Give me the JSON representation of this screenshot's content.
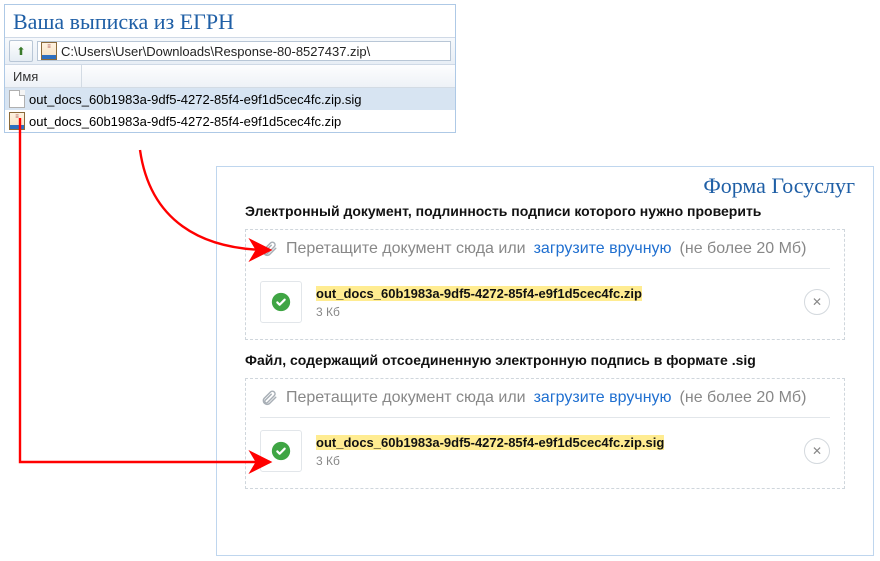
{
  "explorer": {
    "title": "Ваша выписка из ЕГРН",
    "path": "C:\\Users\\User\\Downloads\\Response-80-8527437.zip\\",
    "col_name": "Имя",
    "files": [
      {
        "name": "out_docs_60b1983a-9df5-4272-85f4-e9f1d5cec4fc.zip.sig",
        "icon": "blank",
        "selected": true
      },
      {
        "name": "out_docs_60b1983a-9df5-4272-85f4-e9f1d5cec4fc.zip",
        "icon": "rar",
        "selected": false
      }
    ]
  },
  "form": {
    "title": "Форма Госуслуг",
    "drop_text": "Перетащите документ сюда или",
    "upload_link": "загрузите вручную",
    "limit_text": "(не более 20 Мб)",
    "sections": [
      {
        "label": "Электронный документ, подлинность подписи которого нужно проверить",
        "file_name_hl": "out_docs_",
        "file_name_rest": "60b1983a-9df5-4272-85f4-e9f1d5cec4fc.zip",
        "file_size": "3 Кб"
      },
      {
        "label": "Файл, содержащий отсоединенную электронную подпись в формате .sig",
        "file_name_hl": "out_docs_",
        "file_name_rest": "60b1983a-9df5-4272-85f4-e9f1d5cec4fc.zip.sig",
        "file_size": "3 Кб"
      }
    ]
  }
}
